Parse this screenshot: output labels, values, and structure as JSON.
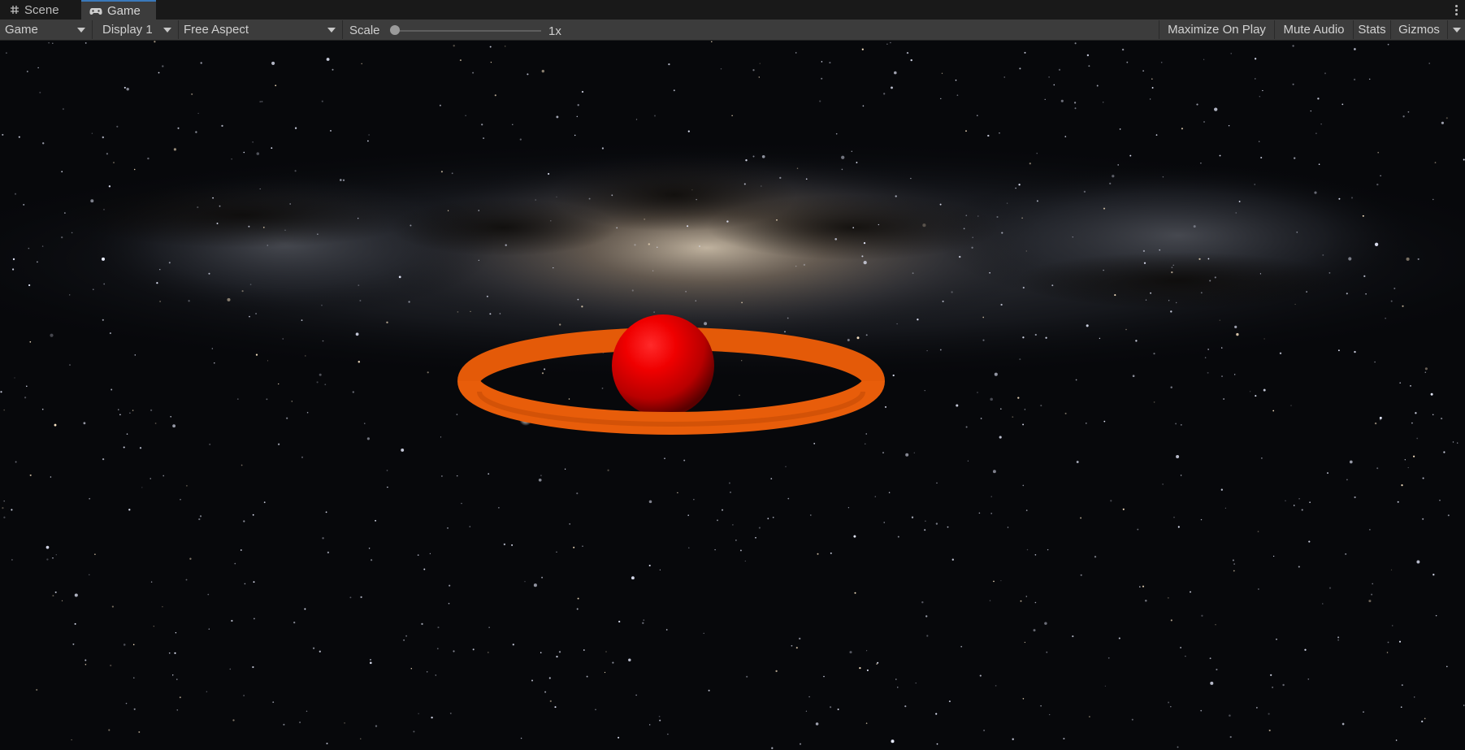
{
  "tabs": [
    {
      "label": "Scene",
      "icon": "grid-hash-icon"
    },
    {
      "label": "Game",
      "icon": "gamepad-icon",
      "active": true
    }
  ],
  "toolbar": {
    "view_select": "Game",
    "display_select": "Display 1",
    "aspect_select": "Free Aspect",
    "scale_label": "Scale",
    "scale_value": "1x",
    "maximize_label": "Maximize On Play",
    "mute_label": "Mute Audio",
    "stats_label": "Stats",
    "gizmos_label": "Gizmos"
  },
  "scene": {
    "background": "milky-way-skybox",
    "planet_color": "#e00000",
    "ring_color": "#e85d0a"
  },
  "colors": {
    "tab_active_accent": "#3a79bb",
    "toolbar_bg": "#3c3c3c",
    "tabbar_bg": "#191919"
  }
}
